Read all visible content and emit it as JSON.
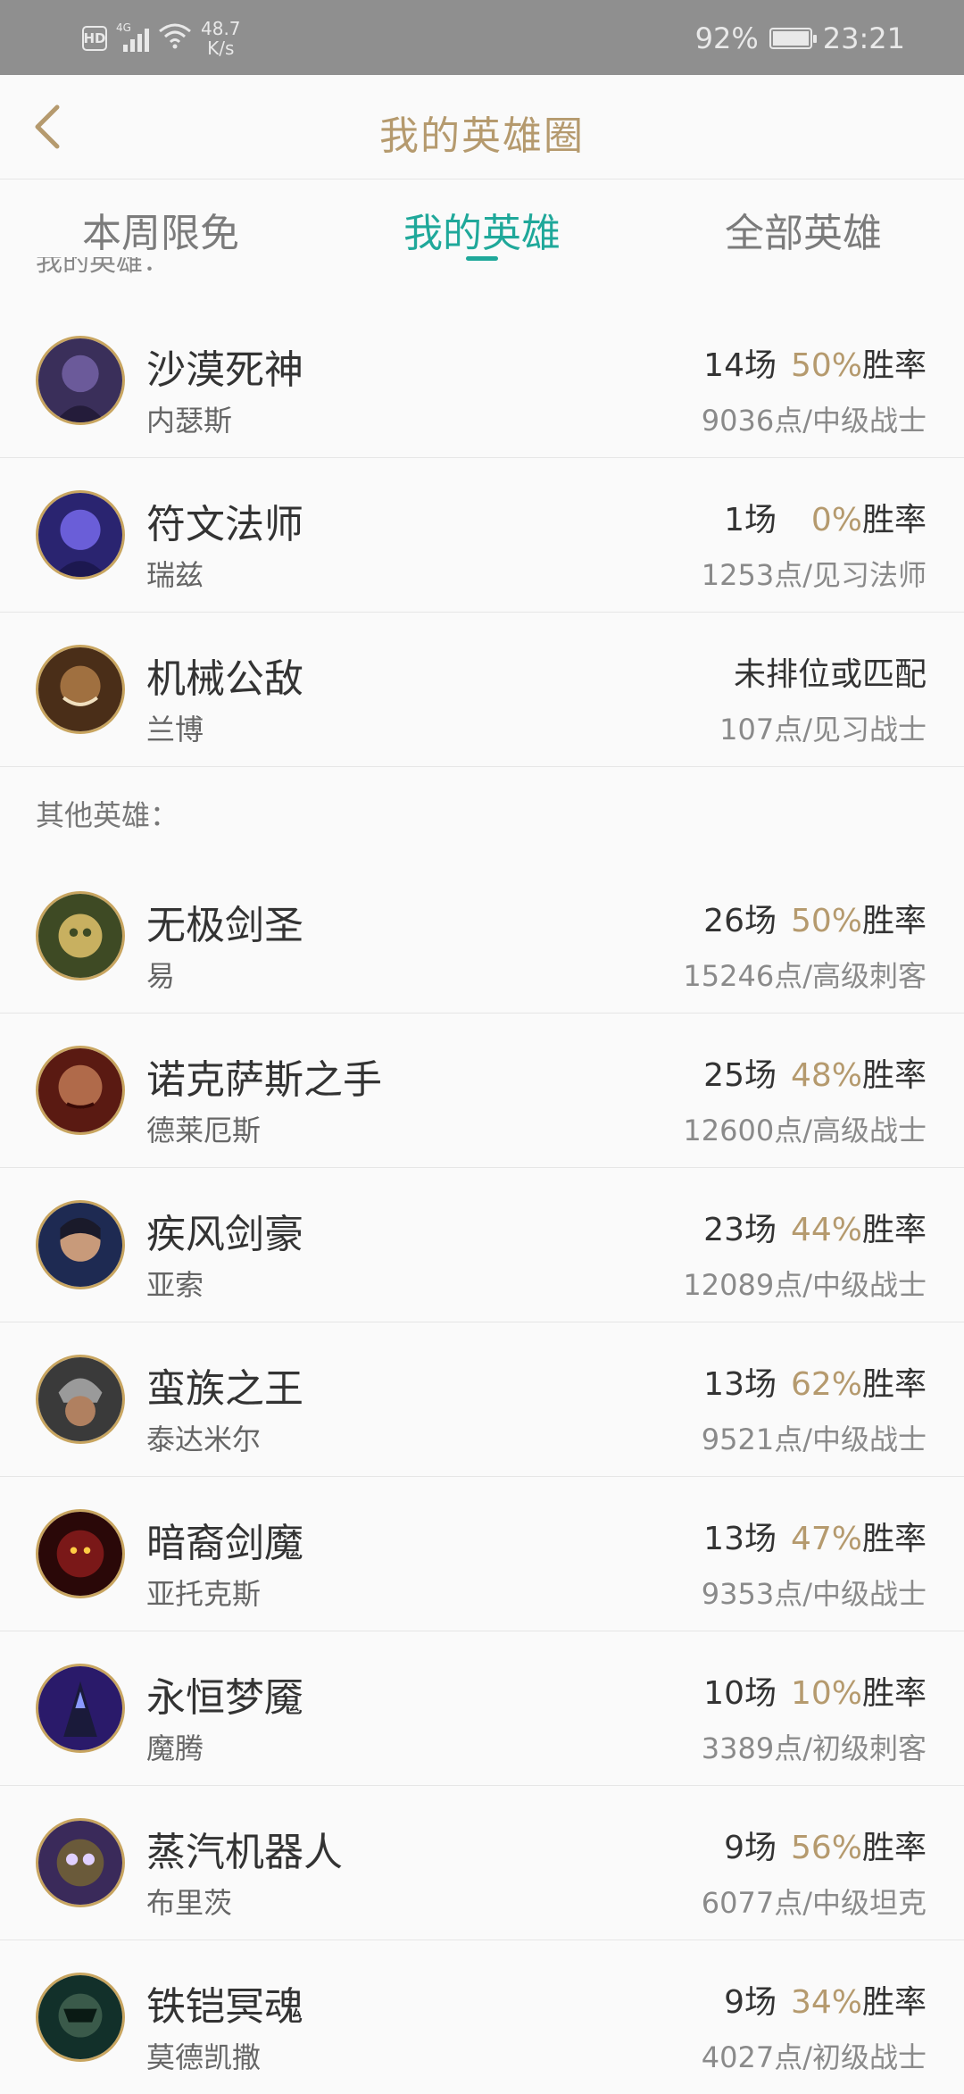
{
  "status_bar": {
    "hd": "HD",
    "network": "4G",
    "speed_value": "48.7",
    "speed_unit": "K/s",
    "battery": "92%",
    "time": "23:21",
    "icons": [
      "hd-icon",
      "signal-icon",
      "wifi-icon",
      "battery-charging-icon"
    ]
  },
  "header": {
    "title": "我的英雄圈",
    "back_icon": "chevron-left-icon"
  },
  "tabs": [
    {
      "label": "本周限免",
      "active": false
    },
    {
      "label": "我的英雄",
      "active": true
    },
    {
      "label": "全部英雄",
      "active": false
    }
  ],
  "clipped_section_label": "我的英雄：",
  "other_section_label": "其他英雄：",
  "colors": {
    "accent_gold": "#b59a6e",
    "accent_teal": "#1fa89a"
  },
  "featured_heroes": [
    {
      "title": "沙漠死神",
      "name": "内瑟斯",
      "games": "14场",
      "rate": "50%",
      "rate_label": "胜率",
      "points": "9036点/中级战士",
      "avatar_hue": "#3a2f5a"
    },
    {
      "title": "符文法师",
      "name": "瑞兹",
      "games": "1场",
      "rate": "0%",
      "rate_label": "胜率",
      "points": "1253点/见习法师",
      "avatar_hue": "#4a44b8"
    },
    {
      "title": "机械公敌",
      "name": "兰博",
      "status": "未排位或匹配",
      "points": "107点/见习战士",
      "avatar_hue": "#6a4a2a"
    }
  ],
  "other_heroes": [
    {
      "title": "无极剑圣",
      "name": "易",
      "games": "26场",
      "rate": "50%",
      "rate_label": "胜率",
      "points": "15246点/高级刺客",
      "avatar_hue": "#5a6a3a"
    },
    {
      "title": "诺克萨斯之手",
      "name": "德莱厄斯",
      "games": "25场",
      "rate": "48%",
      "rate_label": "胜率",
      "points": "12600点/高级战士",
      "avatar_hue": "#7a2a1e"
    },
    {
      "title": "疾风剑豪",
      "name": "亚索",
      "games": "23场",
      "rate": "44%",
      "rate_label": "胜率",
      "points": "12089点/中级战士",
      "avatar_hue": "#2a3a6a"
    },
    {
      "title": "蛮族之王",
      "name": "泰达米尔",
      "games": "13场",
      "rate": "62%",
      "rate_label": "胜率",
      "points": "9521点/中级战士",
      "avatar_hue": "#5a5a5a"
    },
    {
      "title": "暗裔剑魔",
      "name": "亚托克斯",
      "games": "13场",
      "rate": "47%",
      "rate_label": "胜率",
      "points": "9353点/中级战士",
      "avatar_hue": "#6a1a1a"
    },
    {
      "title": "永恒梦魇",
      "name": "魔腾",
      "games": "10场",
      "rate": "10%",
      "rate_label": "胜率",
      "points": "3389点/初级刺客",
      "avatar_hue": "#3a2a8a"
    },
    {
      "title": "蒸汽机器人",
      "name": "布里茨",
      "games": "9场",
      "rate": "56%",
      "rate_label": "胜率",
      "points": "6077点/中级坦克",
      "avatar_hue": "#5a3a7a"
    },
    {
      "title": "铁铠冥魂",
      "name": "莫德凯撒",
      "games": "9场",
      "rate": "34%",
      "rate_label": "胜率",
      "points": "4027点/初级战士",
      "avatar_hue": "#1e4a3a"
    }
  ]
}
